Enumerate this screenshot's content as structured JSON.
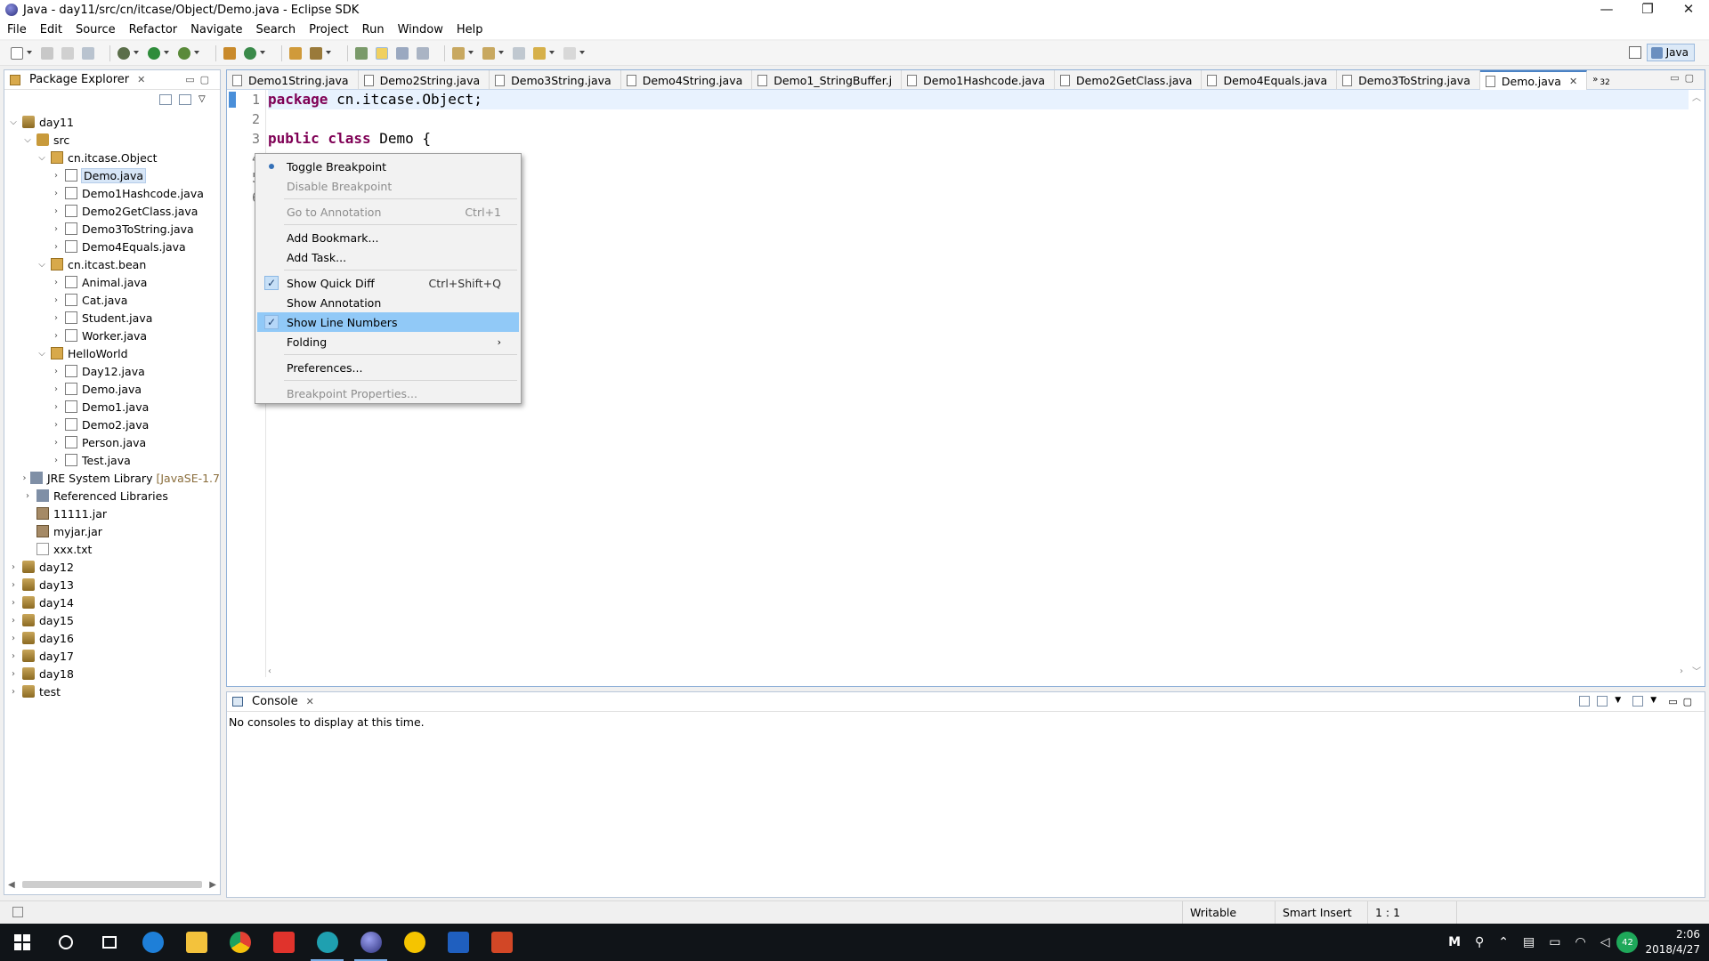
{
  "window": {
    "title": "Java - day11/src/cn/itcase/Object/Demo.java - Eclipse SDK",
    "controls": [
      "—",
      "❐",
      "✕"
    ]
  },
  "menu": [
    "File",
    "Edit",
    "Source",
    "Refactor",
    "Navigate",
    "Search",
    "Project",
    "Run",
    "Window",
    "Help"
  ],
  "perspective": {
    "label": "Java"
  },
  "package_explorer": {
    "title": "Package Explorer",
    "close": "✕",
    "tree": [
      {
        "label": "day11",
        "level": 0,
        "icon": "project",
        "chev": "⌵"
      },
      {
        "label": "src",
        "level": 1,
        "icon": "src",
        "chev": "⌵"
      },
      {
        "label": "cn.itcase.Object",
        "level": 2,
        "icon": "package",
        "chev": "⌵"
      },
      {
        "label": "Demo.java",
        "level": 3,
        "icon": "java",
        "chev": "›",
        "selected": true
      },
      {
        "label": "Demo1Hashcode.java",
        "level": 3,
        "icon": "java",
        "chev": "›"
      },
      {
        "label": "Demo2GetClass.java",
        "level": 3,
        "icon": "java",
        "chev": "›"
      },
      {
        "label": "Demo3ToString.java",
        "level": 3,
        "icon": "java",
        "chev": "›"
      },
      {
        "label": "Demo4Equals.java",
        "level": 3,
        "icon": "java",
        "chev": "›"
      },
      {
        "label": "cn.itcast.bean",
        "level": 2,
        "icon": "package",
        "chev": "⌵"
      },
      {
        "label": "Animal.java",
        "level": 3,
        "icon": "java",
        "chev": "›"
      },
      {
        "label": "Cat.java",
        "level": 3,
        "icon": "java",
        "chev": "›"
      },
      {
        "label": "Student.java",
        "level": 3,
        "icon": "java",
        "chev": "›"
      },
      {
        "label": "Worker.java",
        "level": 3,
        "icon": "java",
        "chev": "›"
      },
      {
        "label": "HelloWorld",
        "level": 2,
        "icon": "package",
        "chev": "⌵"
      },
      {
        "label": "Day12.java",
        "level": 3,
        "icon": "java",
        "chev": "›"
      },
      {
        "label": "Demo.java",
        "level": 3,
        "icon": "java",
        "chev": "›"
      },
      {
        "label": "Demo1.java",
        "level": 3,
        "icon": "java",
        "chev": "›"
      },
      {
        "label": "Demo2.java",
        "level": 3,
        "icon": "java",
        "chev": "›"
      },
      {
        "label": "Person.java",
        "level": 3,
        "icon": "java",
        "chev": "›"
      },
      {
        "label": "Test.java",
        "level": 3,
        "icon": "java",
        "chev": "›"
      },
      {
        "label": "JRE System Library",
        "suffix": "[JavaSE-1.7",
        "level": 1,
        "icon": "lib",
        "chev": "›"
      },
      {
        "label": "Referenced Libraries",
        "level": 1,
        "icon": "lib",
        "chev": "›"
      },
      {
        "label": "11111.jar",
        "level": 1,
        "icon": "jar",
        "chev": ""
      },
      {
        "label": "myjar.jar",
        "level": 1,
        "icon": "jar",
        "chev": ""
      },
      {
        "label": "xxx.txt",
        "level": 1,
        "icon": "txt",
        "chev": ""
      },
      {
        "label": "day12",
        "level": 0,
        "icon": "project",
        "chev": "›"
      },
      {
        "label": "day13",
        "level": 0,
        "icon": "project",
        "chev": "›"
      },
      {
        "label": "day14",
        "level": 0,
        "icon": "project",
        "chev": "›"
      },
      {
        "label": "day15",
        "level": 0,
        "icon": "project",
        "chev": "›"
      },
      {
        "label": "day16",
        "level": 0,
        "icon": "project",
        "chev": "›"
      },
      {
        "label": "day17",
        "level": 0,
        "icon": "project",
        "chev": "›"
      },
      {
        "label": "day18",
        "level": 0,
        "icon": "project",
        "chev": "›"
      },
      {
        "label": "test",
        "level": 0,
        "icon": "project",
        "chev": "›"
      }
    ]
  },
  "editor": {
    "tabs": [
      {
        "label": "Demo1String.java"
      },
      {
        "label": "Demo2String.java"
      },
      {
        "label": "Demo3String.java"
      },
      {
        "label": "Demo4String.java"
      },
      {
        "label": "Demo1_StringBuffer.j"
      },
      {
        "label": "Demo1Hashcode.java"
      },
      {
        "label": "Demo2GetClass.java"
      },
      {
        "label": "Demo4Equals.java"
      },
      {
        "label": "Demo3ToString.java"
      },
      {
        "label": "Demo.java",
        "active": true
      }
    ],
    "overflow_symbol": "»",
    "overflow_count": "32",
    "line_numbers": [
      "1",
      "2",
      "3",
      "4",
      "5",
      "6"
    ],
    "code": {
      "line1_kw": "package",
      "line1_rest": " cn.itcase.Object;",
      "line3_kw": "public class",
      "line3_rest": " Demo {"
    }
  },
  "context_menu": [
    {
      "label": "Toggle Breakpoint",
      "mark": "dot"
    },
    {
      "label": "Disable Breakpoint",
      "disabled": true
    },
    {
      "sep": true
    },
    {
      "label": "Go to Annotation",
      "shortcut": "Ctrl+1",
      "disabled": true
    },
    {
      "sep": true
    },
    {
      "label": "Add Bookmark..."
    },
    {
      "label": "Add Task..."
    },
    {
      "sep": true
    },
    {
      "label": "Show Quick Diff",
      "shortcut": "Ctrl+Shift+Q",
      "mark": "check"
    },
    {
      "label": "Show Annotation"
    },
    {
      "label": "Show Line Numbers",
      "mark": "check",
      "highlighted": true
    },
    {
      "label": "Folding",
      "submenu": true
    },
    {
      "sep": true
    },
    {
      "label": "Preferences..."
    },
    {
      "sep": true
    },
    {
      "label": "Breakpoint Properties...",
      "disabled": true
    }
  ],
  "console": {
    "title": "Console",
    "close": "✕",
    "message": "No consoles to display at this time."
  },
  "status": {
    "writable": "Writable",
    "insert_mode": "Smart Insert",
    "position": "1 : 1"
  },
  "taskbar": {
    "time": "2:06",
    "date": "2018/4/27",
    "badge": "42",
    "tray_letter": "M"
  },
  "colors": {
    "keyword": "#7f0055",
    "menu_highlight": "#91c9f7",
    "active_tab_border": "#4a82c4"
  }
}
